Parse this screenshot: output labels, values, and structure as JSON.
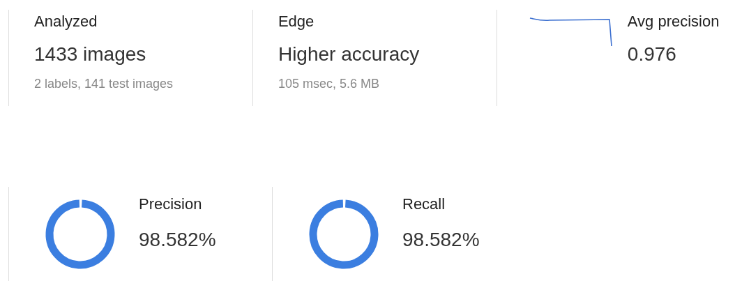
{
  "stats": [
    {
      "label": "Analyzed",
      "value": "1433 images",
      "detail": "2 labels, 141 test images"
    },
    {
      "label": "Edge",
      "value": "Higher accuracy",
      "detail": "105 msec, 5.6 MB"
    },
    {
      "label": "Avg precision",
      "value": "0.976"
    }
  ],
  "meters": [
    {
      "label": "Precision",
      "value": "98.582%",
      "level": 0.98582
    },
    {
      "label": "Recall",
      "value": "98.582%",
      "level": 0.98582
    }
  ]
}
